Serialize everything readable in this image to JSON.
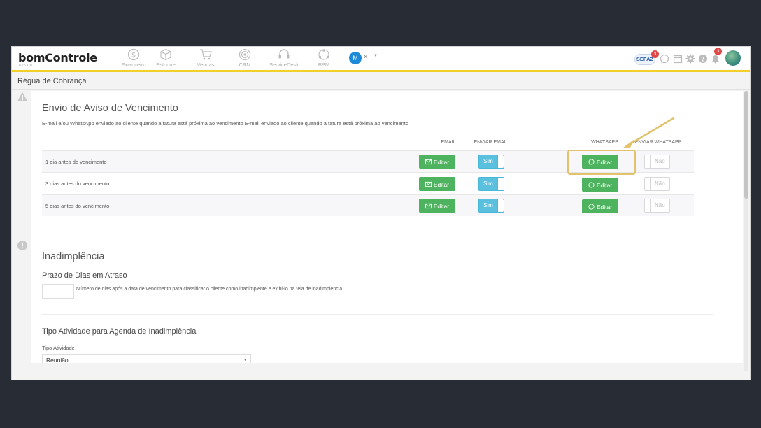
{
  "app": {
    "logo": "bomControle",
    "version": "8.76.106"
  },
  "nav": {
    "items": [
      {
        "label": "Financeiro",
        "icon": "dollar-circle-icon"
      },
      {
        "label": "Estoque",
        "icon": "box-icon"
      },
      {
        "label": "Vendas",
        "icon": "cart-icon"
      },
      {
        "label": "CRM",
        "icon": "target-icon"
      },
      {
        "label": "ServiceDesk",
        "icon": "headset-icon"
      },
      {
        "label": "BPM",
        "icon": "workflow-icon"
      }
    ],
    "company_avatar": "M",
    "close": "×"
  },
  "toolbar": {
    "sefaz_label": "SEFAZ",
    "sefaz_badge": "3",
    "notifications_badge": "3"
  },
  "page": {
    "title": "Régua de Cobrança"
  },
  "aviso": {
    "title": "Envio de Aviso de Vencimento",
    "description": "E-mail e/ou WhatsApp enviado ao cliente quando a fatura está próxima ao vencimento E-mail enviado ao cliente quando a fatura está próxima ao vencimento",
    "columns": {
      "email": "EMAIL",
      "enviar_email": "ENVIAR EMAIL",
      "whatsapp": "WHATSAPP",
      "enviar_whatsapp": "ENVIAR WHATSAPP"
    },
    "rows": [
      {
        "label": "1 dia antes do vencimento",
        "email_button": "Editar",
        "enviar_email": "Sim",
        "whatsapp_button": "Editar",
        "enviar_whatsapp": "Não"
      },
      {
        "label": "3 dias antes do vencimento",
        "email_button": "Editar",
        "enviar_email": "Sim",
        "whatsapp_button": "Editar",
        "enviar_whatsapp": "Não"
      },
      {
        "label": "5 dias antes do vencimento",
        "email_button": "Editar",
        "enviar_email": "Sim",
        "whatsapp_button": "Editar",
        "enviar_whatsapp": "Não"
      }
    ]
  },
  "inadimplencia": {
    "title": "Inadimplência",
    "prazo_title": "Prazo de Dias em Atraso",
    "prazo_value": "",
    "prazo_help": "Número de dias após a data de vencimento para classificar o cliente como inadimplente e exibi-lo na tela de inadimplência.",
    "tipo_title": "Tipo Atividade para Agenda de Inadimplência",
    "tipo_label": "Tipo Atividade",
    "tipo_value": "Reunião"
  },
  "colors": {
    "accent_yellow": "#f2d028",
    "success_green": "#4db35e",
    "toggle_blue": "#5bc0de",
    "highlight": "#e2c26a",
    "badge_red": "#e04848"
  }
}
